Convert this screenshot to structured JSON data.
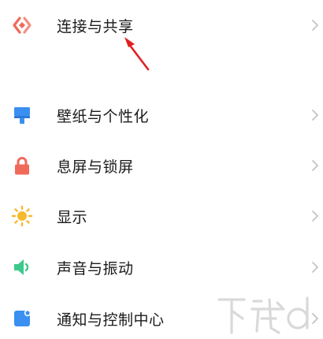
{
  "settings": {
    "items": [
      {
        "label": "连接与共享",
        "icon": "connection-share-icon",
        "color": "#f06a5a"
      },
      {
        "label": "壁纸与个性化",
        "icon": "wallpaper-icon",
        "color": "#3a8ff0"
      },
      {
        "label": "息屏与锁屏",
        "icon": "lock-icon",
        "color": "#f06a5a"
      },
      {
        "label": "显示",
        "icon": "sun-icon",
        "color": "#f6b92e"
      },
      {
        "label": "声音与振动",
        "icon": "speaker-icon",
        "color": "#3dc98a"
      },
      {
        "label": "通知与控制中心",
        "icon": "notification-icon",
        "color": "#3a8ff0"
      }
    ]
  },
  "annotation": {
    "color": "#e02020"
  },
  "watermark": {
    "icon": "site-logo-watermark"
  }
}
